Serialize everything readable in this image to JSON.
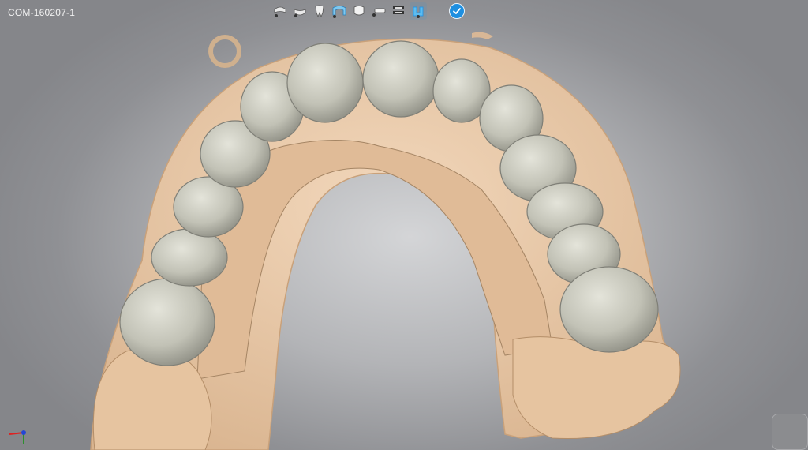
{
  "case": {
    "id": "COM-160207-1"
  },
  "toolbar": {
    "tools": [
      {
        "icon": "upper-jaw-icon"
      },
      {
        "icon": "lower-jaw-icon"
      },
      {
        "icon": "single-tooth-icon"
      },
      {
        "icon": "bridge-icon"
      },
      {
        "icon": "crown-icon"
      },
      {
        "icon": "implant-icon"
      },
      {
        "icon": "layers-icon"
      },
      {
        "icon": "arch-highlight-icon"
      }
    ],
    "confirm_icon": "check-circle-icon"
  },
  "colors": {
    "gingiva": "#ecc9a7",
    "tooth": "#bfbfb3",
    "accent": "#1e8fe0"
  }
}
